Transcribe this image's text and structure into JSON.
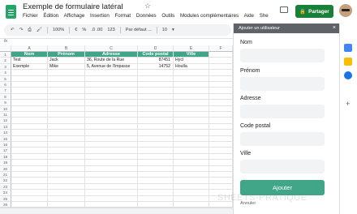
{
  "app": {
    "title": "Exemple de formulaire latéral",
    "menus": [
      "Fichier",
      "Édition",
      "Affichage",
      "Insertion",
      "Format",
      "Données",
      "Outils",
      "Modules complémentaires",
      "Aide",
      "She"
    ],
    "share_label": "Partager"
  },
  "toolbar": {
    "zoom": "100%",
    "currency": "€",
    "percent": "%",
    "decimals": ".0 .00",
    "number_format": "123",
    "font": "Par défaut ...",
    "font_size": "10"
  },
  "grid": {
    "columns": [
      "A",
      "B",
      "C",
      "D",
      "E",
      "F"
    ],
    "row_numbers": [
      "1",
      "2",
      "3",
      "4",
      "5",
      "6",
      "7",
      "8",
      "9",
      "10",
      "11",
      "12",
      "13",
      "14",
      "15",
      "16",
      "17",
      "18",
      "19",
      "20",
      "21",
      "22",
      "23",
      "24",
      "25",
      "26",
      "27"
    ],
    "headers": [
      "Nom",
      "Prénom",
      "Adresse",
      "Code postal",
      "Ville"
    ],
    "rows": [
      [
        "Test",
        "Jack",
        "36, Route de la Rue",
        "87451",
        "Hycl"
      ],
      [
        "Exemple",
        "Mike",
        "5, Avenue de l'Impasse",
        "14752",
        "Houlla"
      ]
    ]
  },
  "sidebar": {
    "title": "Ajouter un utilisateur",
    "fields": [
      {
        "label": "Nom",
        "value": ""
      },
      {
        "label": "Prénom",
        "value": ""
      },
      {
        "label": "Adresse",
        "value": ""
      },
      {
        "label": "Code postal",
        "value": ""
      },
      {
        "label": "Ville",
        "value": ""
      }
    ],
    "submit_label": "Ajouter",
    "cancel_label": "Annuler"
  },
  "watermark": "SHEETS-PRATIQUE",
  "colors": {
    "accent": "#41a588",
    "share": "#188038",
    "sidebar_header": "#5f6368"
  }
}
